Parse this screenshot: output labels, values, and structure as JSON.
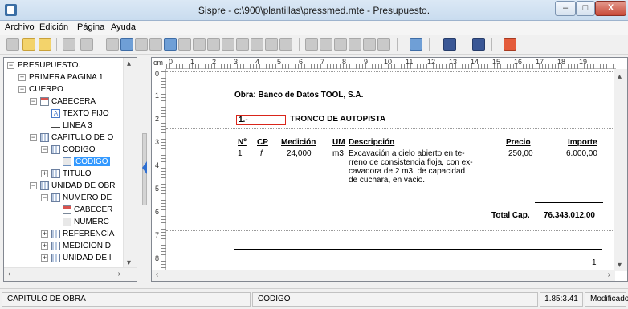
{
  "window": {
    "title": "Sispre - c:\\900\\plantillas\\pressmed.mte - Presupuesto.",
    "min_symbol": "–",
    "max_symbol": "□",
    "close_symbol": "X"
  },
  "menu": {
    "items": [
      "Archivo",
      "Edición",
      "Página",
      "Ayuda"
    ]
  },
  "tree": {
    "nodes": [
      {
        "label": "PRESUPUESTO.",
        "icon": "doc-icon",
        "expander": "−"
      },
      {
        "label": "PRIMERA PAGINA 1",
        "icon": "doc-icon",
        "expander": "+"
      },
      {
        "label": "CUERPO",
        "icon": "doc-icon",
        "expander": "−"
      },
      {
        "label": "CABECERA",
        "icon": "header-icon",
        "expander": "−"
      },
      {
        "label": "TEXTO FIJO",
        "icon": "text-icon",
        "expander": ""
      },
      {
        "label": "LINEA 3",
        "icon": "line-icon",
        "expander": ""
      },
      {
        "label": "CAPITULO DE O",
        "icon": "grid-icon",
        "expander": "−"
      },
      {
        "label": "CODIGO",
        "icon": "grid-icon",
        "expander": "−"
      },
      {
        "label": "CODIGO",
        "icon": "field-icon",
        "expander": ""
      },
      {
        "label": "TITULO",
        "icon": "grid-icon",
        "expander": "+"
      },
      {
        "label": "UNIDAD DE OBR",
        "icon": "grid-icon",
        "expander": "−"
      },
      {
        "label": "NUMERO DE",
        "icon": "grid-icon",
        "expander": "−"
      },
      {
        "label": "CABECER",
        "icon": "header-icon",
        "expander": ""
      },
      {
        "label": "NUMERC",
        "icon": "field-icon",
        "expander": ""
      },
      {
        "label": "REFERENCIA",
        "icon": "grid-icon",
        "expander": "+"
      },
      {
        "label": "MEDICION D",
        "icon": "grid-icon",
        "expander": "+"
      },
      {
        "label": "UNIDAD DE I",
        "icon": "grid-icon",
        "expander": "+"
      }
    ]
  },
  "ruler": {
    "unit": "cm",
    "h_ticks": [
      "0",
      "1",
      "2",
      "3",
      "4",
      "5",
      "6",
      "7",
      "8",
      "9",
      "10",
      "11",
      "12",
      "13",
      "14",
      "15",
      "16",
      "17",
      "18",
      "19"
    ],
    "v_ticks": [
      "0",
      "1",
      "2",
      "3",
      "4",
      "5",
      "6",
      "7",
      "8"
    ]
  },
  "document": {
    "obra_line": "Obra: Banco de Datos TOOL, S.A.",
    "chapter_code": "1.-",
    "chapter_title": "TRONCO DE AUTOPISTA",
    "columns": {
      "num": "Nº",
      "cp": "CP",
      "medicion": "Medición",
      "um": "UM",
      "descripcion": "Descripción",
      "precio": "Precio",
      "importe": "Importe"
    },
    "row": {
      "num": "1",
      "cp": "f",
      "medicion": "24,000",
      "um": "m3",
      "descripcion_lines": [
        "Excavación a cielo abierto en te-",
        "rreno de consistencia floja, con ex-",
        "cavadora de 2 m3. de capacidad",
        "de cuchara, en vacio."
      ],
      "precio": "250,00",
      "importe": "6.000,00"
    },
    "total_label": "Total Cap.",
    "total_value": "76.343.012,00",
    "page_number": "1"
  },
  "statusbar": {
    "section": "CAPITULO DE OBRA",
    "field": "CODIGO",
    "position": "1.85:3.41",
    "state": "Modificado"
  }
}
